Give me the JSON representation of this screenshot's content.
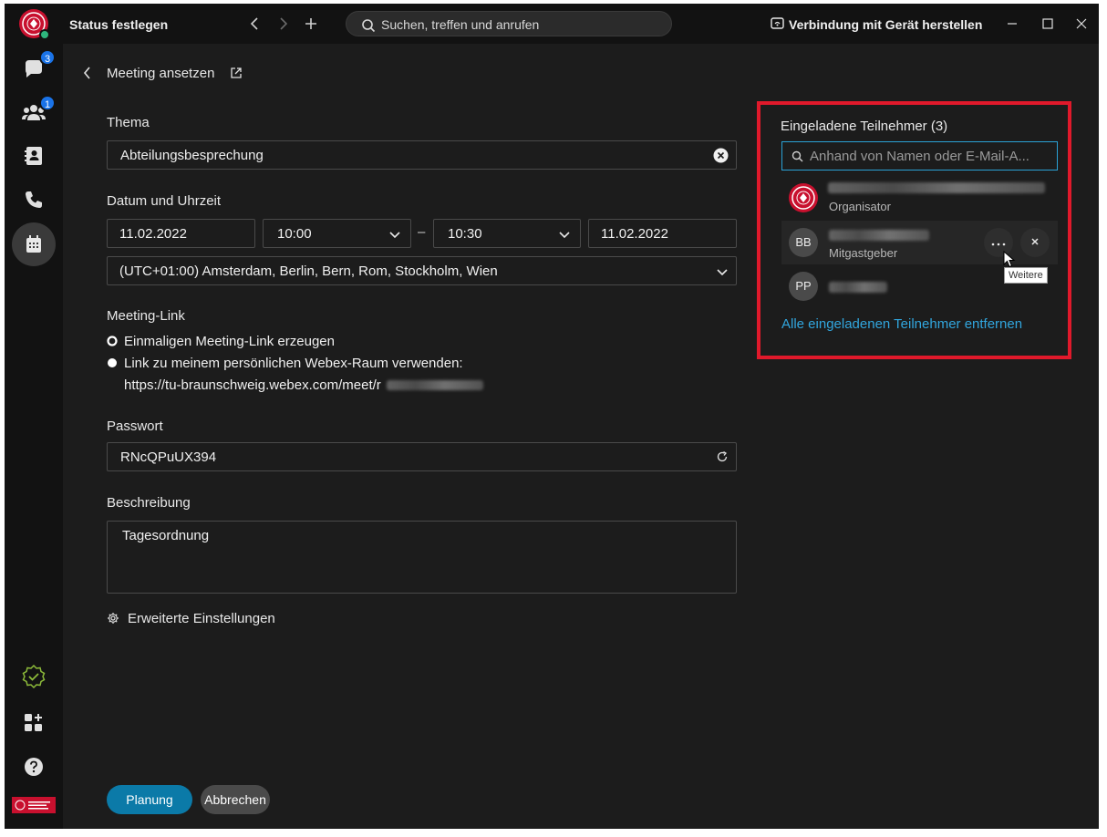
{
  "titlebar": {
    "status_label": "Status festlegen",
    "search_placeholder": "Suchen, treffen und anrufen",
    "connect_device_label": "Verbindung mit Gerät herstellen"
  },
  "sidebar": {
    "items": [
      {
        "name": "messaging",
        "icon": "chat-icon",
        "badge": "3"
      },
      {
        "name": "teams",
        "icon": "people-icon",
        "badge": "1"
      },
      {
        "name": "contacts",
        "icon": "contacts-icon",
        "badge": ""
      },
      {
        "name": "calling",
        "icon": "phone-icon",
        "badge": ""
      },
      {
        "name": "meetings",
        "icon": "calendar-icon",
        "badge": ""
      }
    ],
    "bottom": [
      "check-status-icon",
      "apps-icon",
      "help-icon",
      "university-logo"
    ]
  },
  "form": {
    "page_title": "Meeting ansetzen",
    "thema_label": "Thema",
    "thema_value": "Abteilungsbesprechung",
    "datetime_label": "Datum und Uhrzeit",
    "start_date": "11.02.2022",
    "start_time": "10:00",
    "dash": "–",
    "end_time": "10:30",
    "end_date": "11.02.2022",
    "timezone": "(UTC+01:00) Amsterdam, Berlin, Bern, Rom, Stockholm, Wien",
    "link_label": "Meeting-Link",
    "radio_once": "Einmaligen Meeting-Link erzeugen",
    "radio_personal": "Link zu meinem persönlichen Webex-Raum verwenden:",
    "personal_url": "https://tu-braunschweig.webex.com/meet/r",
    "password_label": "Passwort",
    "password_value": "RNcQPuUX394",
    "description_label": "Beschreibung",
    "description_value": "Tagesordnung",
    "advanced_label": "Erweiterte Einstellungen",
    "schedule_button": "Planung",
    "cancel_button": "Abbrechen"
  },
  "invitees": {
    "header": "Eingeladene Teilnehmer (3)",
    "search_placeholder": "Anhand von Namen oder E-Mail-A...",
    "people": [
      {
        "initials": "",
        "role": "Organisator"
      },
      {
        "initials": "BB",
        "role": "Mitgastgeber"
      },
      {
        "initials": "PP",
        "role": ""
      }
    ],
    "more_tooltip": "Weitere",
    "remove_all_link": "Alle eingeladenen Teilnehmer entfernen"
  },
  "colors": {
    "accent_blue": "#0b7aa8",
    "link_blue": "#31a6de",
    "highlight_red": "#e0192b",
    "presence_green": "#2eb67d"
  }
}
